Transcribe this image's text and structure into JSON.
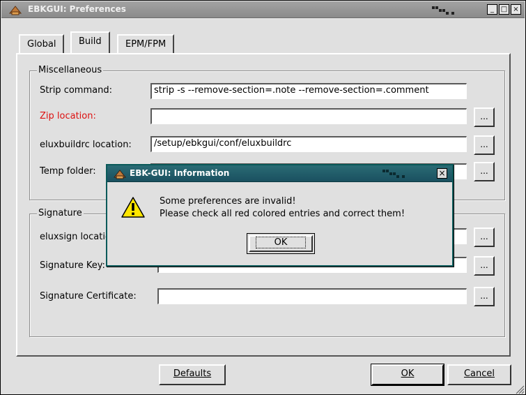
{
  "window": {
    "title": "EBKGUI: Preferences",
    "controls": [
      "_",
      "□",
      "×"
    ]
  },
  "tabs": [
    {
      "label": "Global",
      "active": false
    },
    {
      "label": "Build",
      "active": true
    },
    {
      "label": "EPM/FPM",
      "active": false
    }
  ],
  "misc": {
    "title": "Miscellaneous",
    "strip_label": "Strip command:",
    "strip_value": "strip -s --remove-section=.note --remove-section=.comment",
    "zip_label": "Zip location:",
    "zip_value": "",
    "eluxbuildrc_label": "eluxbuildrc location:",
    "eluxbuildrc_value": "/setup/ebkgui/conf/eluxbuildrc",
    "temp_label": "Temp folder:",
    "temp_value": "",
    "browse_label": "..."
  },
  "signature": {
    "title": "Signature",
    "eluxsign_label": "eluxsign location:",
    "eluxsign_value": "",
    "key_label": "Signature Key:",
    "key_value": "",
    "cert_label": "Signature Certificate:",
    "cert_value": ""
  },
  "footer": {
    "defaults": "Defaults",
    "ok": "OK",
    "cancel": "Cancel"
  },
  "dialog": {
    "title": "EBK-GUI: Information",
    "line1": "Some preferences are invalid!",
    "line2": "Please check all red colored entries and correct them!",
    "ok": "OK",
    "close": "×"
  },
  "colors": {
    "invalid_label": "#dd1111",
    "dialog_title_bg": "#1a5060",
    "window_title_bg": "#8a8a8a"
  }
}
